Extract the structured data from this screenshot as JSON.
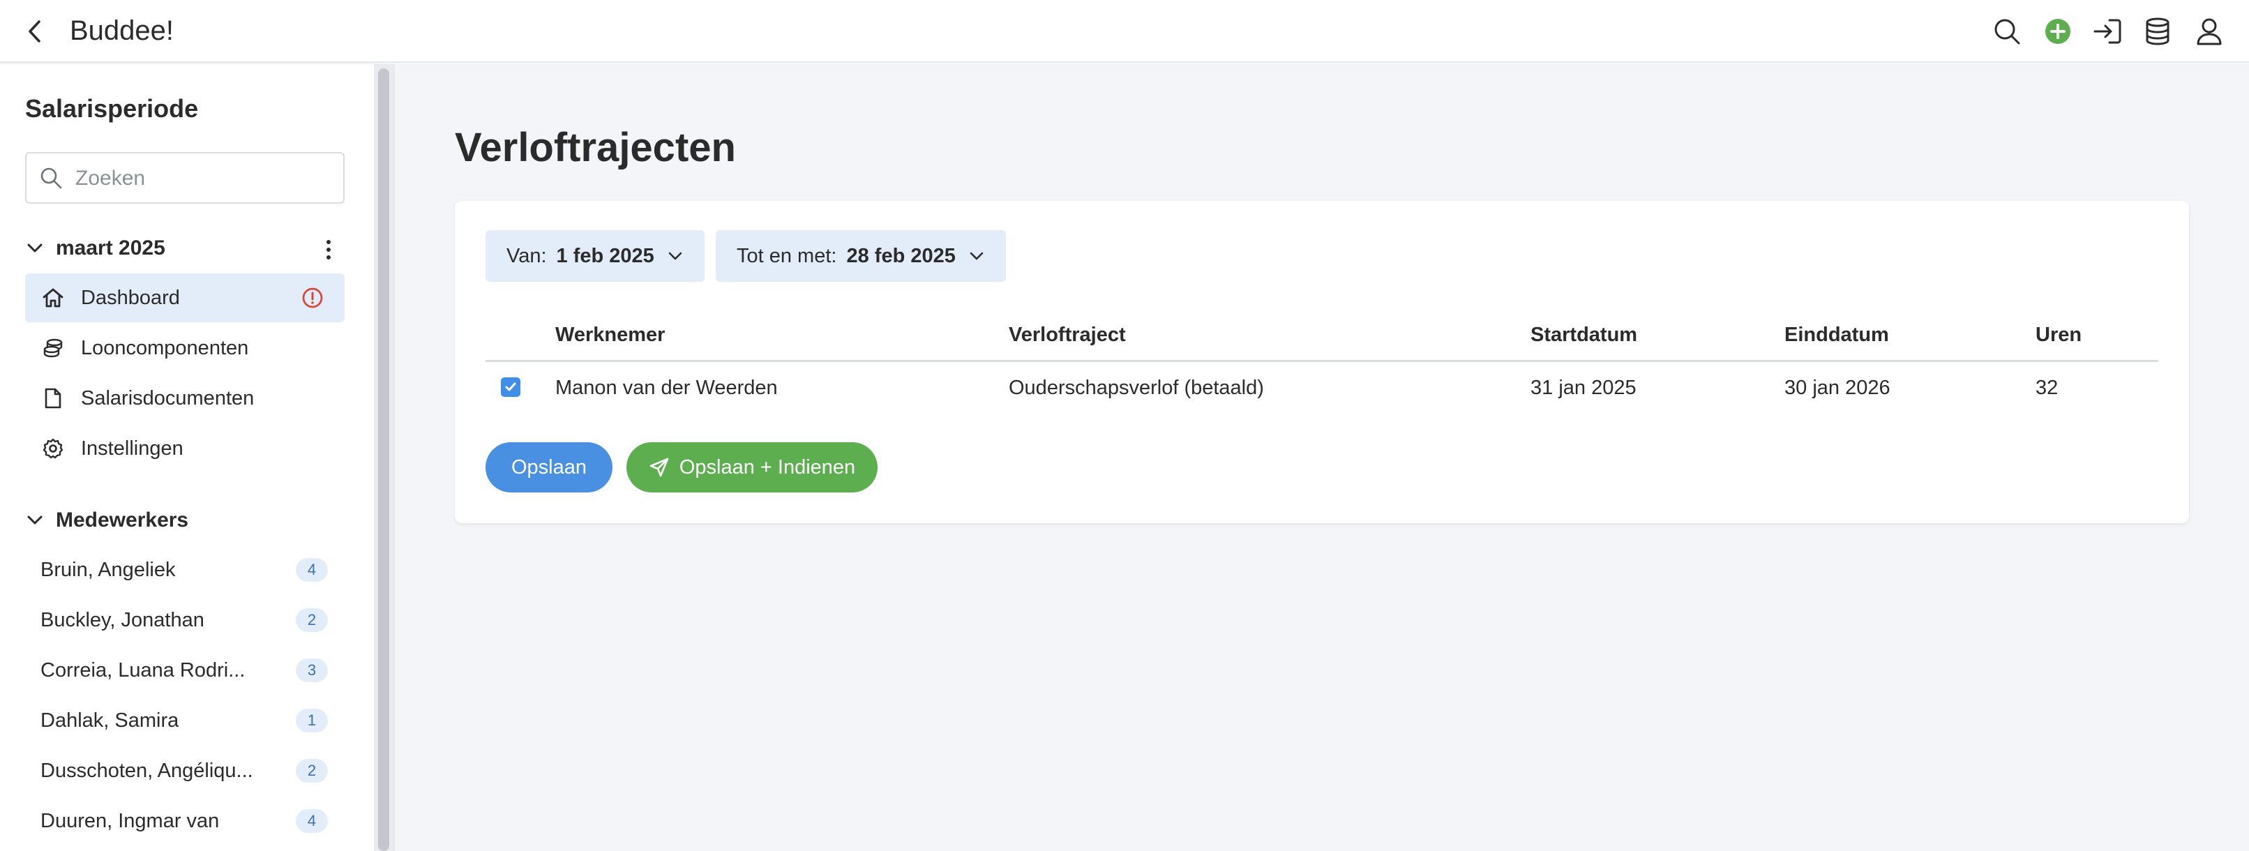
{
  "header": {
    "title": "Buddee!",
    "icons": [
      "back-icon",
      "search-icon",
      "add-icon",
      "login-icon",
      "database-icon",
      "user-icon"
    ],
    "accent_color": "#5cae4f"
  },
  "sidebar": {
    "title": "Salarisperiode",
    "search": {
      "placeholder": "Zoeken",
      "value": ""
    },
    "period": {
      "label": "maart 2025",
      "expanded": true
    },
    "nav_items": [
      {
        "label": "Dashboard",
        "icon": "home-icon",
        "active": true,
        "warning": true
      },
      {
        "label": "Looncomponenten",
        "icon": "coins-icon",
        "active": false
      },
      {
        "label": "Salarisdocumenten",
        "icon": "document-icon",
        "active": false
      },
      {
        "label": "Instellingen",
        "icon": "gear-icon",
        "active": false
      }
    ],
    "employees_group": {
      "label": "Medewerkers",
      "expanded": true
    },
    "employees": [
      {
        "name": "Bruin, Angeliek",
        "count": "4"
      },
      {
        "name": "Buckley, Jonathan",
        "count": "2"
      },
      {
        "name": "Correia, Luana Rodri...",
        "count": "3"
      },
      {
        "name": "Dahlak, Samira",
        "count": "1"
      },
      {
        "name": "Dusschoten, Angéliqu...",
        "count": "2"
      },
      {
        "name": "Duuren, Ingmar van",
        "count": "4"
      }
    ]
  },
  "main": {
    "title": "Verloftrajecten",
    "filters": {
      "from_label": "Van:",
      "from_value": "1 feb 2025",
      "to_label": "Tot en met:",
      "to_value": "28 feb 2025"
    },
    "table": {
      "columns": [
        "Werknemer",
        "Verloftraject",
        "Startdatum",
        "Einddatum",
        "Uren"
      ],
      "rows": [
        {
          "checked": true,
          "werknemer": "Manon van der Weerden",
          "verloftraject": "Ouderschapsverlof (betaald)",
          "startdatum": "31 jan 2025",
          "einddatum": "30 jan 2026",
          "uren": "32"
        }
      ]
    },
    "buttons": {
      "save": "Opslaan",
      "save_submit": "Opslaan + Indienen"
    }
  }
}
